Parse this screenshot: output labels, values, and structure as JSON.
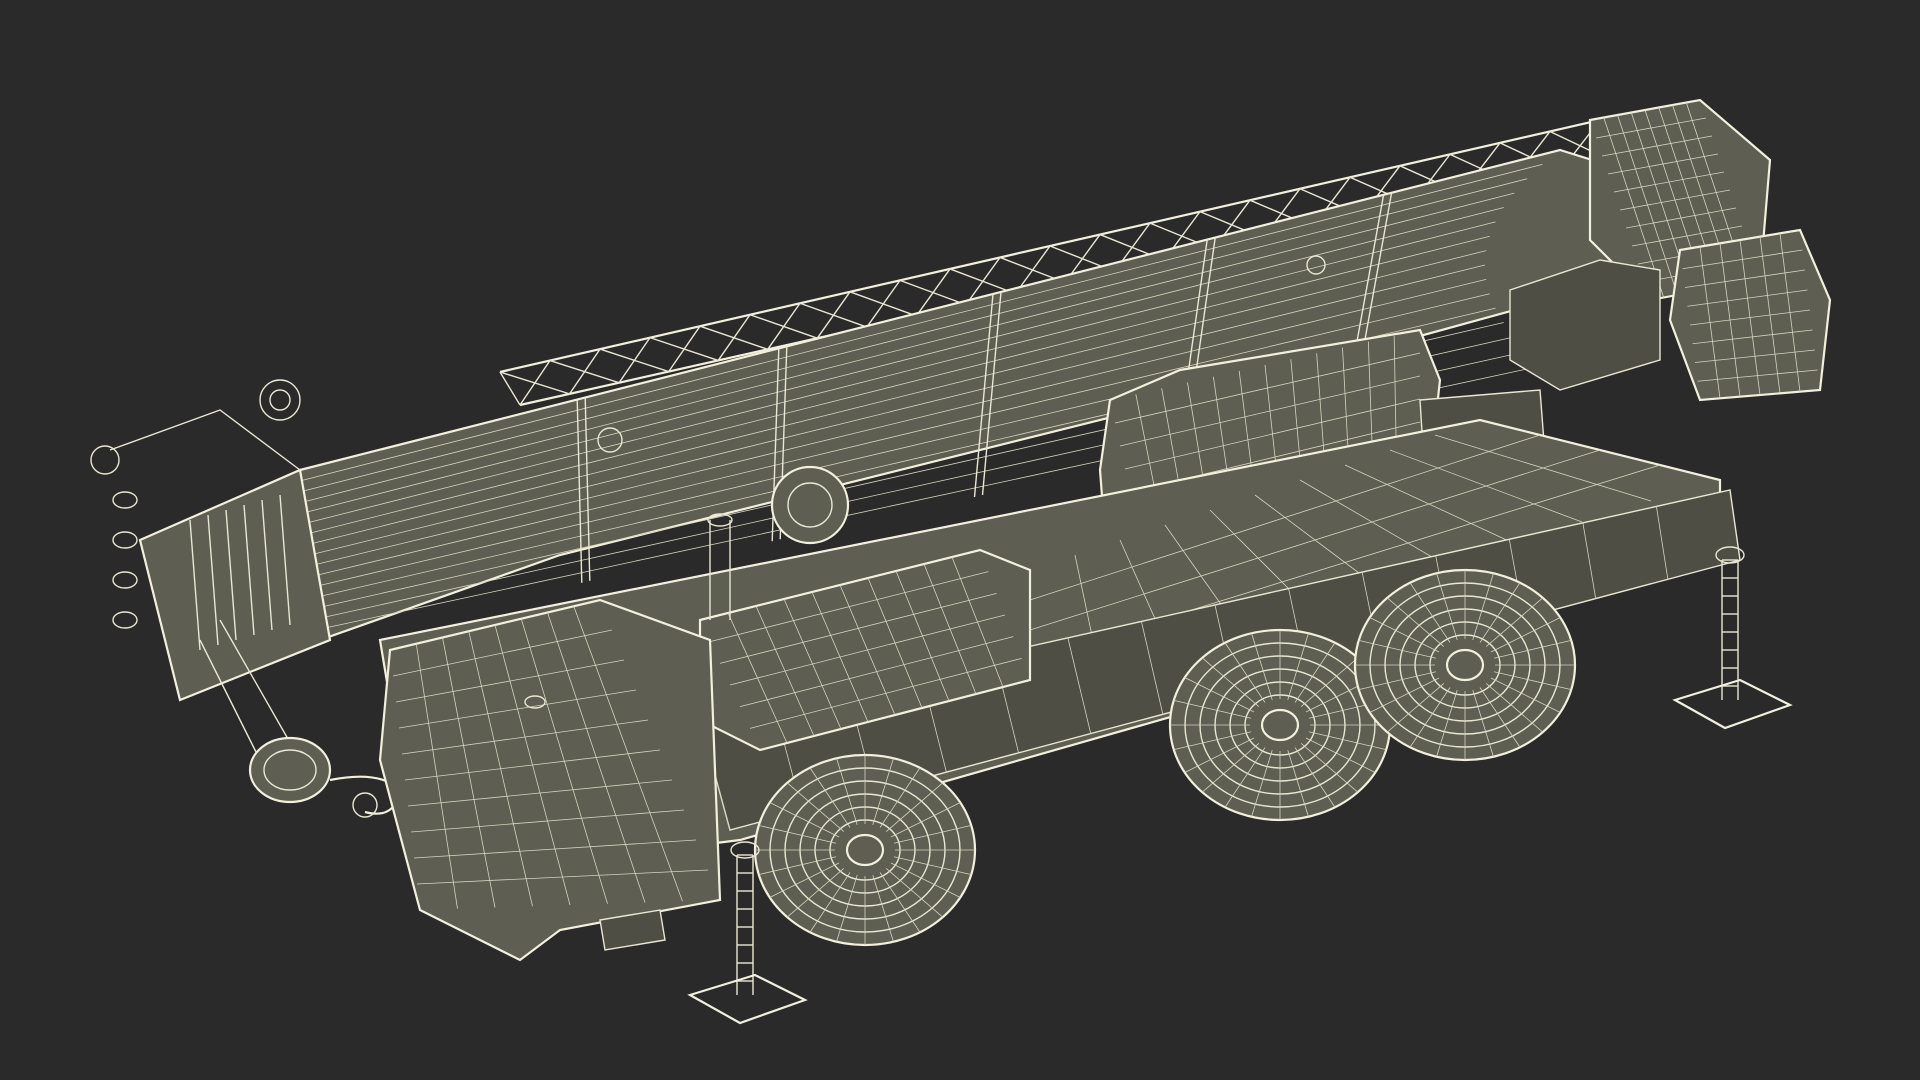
{
  "scene": {
    "subject": "mobile-crane-wireframe",
    "background_color": "#2a2a2a",
    "wire_color": "#e9e7d2",
    "surface_color": "#5e5e52"
  }
}
